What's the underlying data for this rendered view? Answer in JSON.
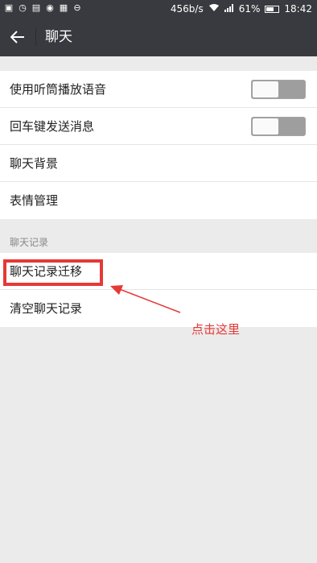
{
  "status_bar": {
    "network_speed": "456b/s",
    "battery_percent": "61%",
    "time": "18:42",
    "icons": [
      "image-icon",
      "timer-icon",
      "gallery-icon",
      "chat-icon",
      "grid-icon",
      "circle-icon",
      "wifi-icon",
      "signal-icon",
      "battery-icon"
    ]
  },
  "header": {
    "title": "聊天",
    "back_icon": "back-arrow-icon"
  },
  "settings": {
    "items": [
      {
        "label": "使用听筒播放语音",
        "toggle": "off"
      },
      {
        "label": "回车键发送消息",
        "toggle": "off"
      },
      {
        "label": "聊天背景"
      },
      {
        "label": "表情管理"
      }
    ]
  },
  "history": {
    "section_title": "聊天记录",
    "items": [
      {
        "label": "聊天记录迁移"
      },
      {
        "label": "清空聊天记录"
      }
    ]
  },
  "annotation": {
    "text": "点击这里",
    "color": "#e53935"
  },
  "colors": {
    "titlebar": "#393a3f",
    "background": "#ebebeb",
    "toggle_off": "#9e9e9e",
    "annotation": "#e53935"
  },
  "battery_level": 0.61
}
